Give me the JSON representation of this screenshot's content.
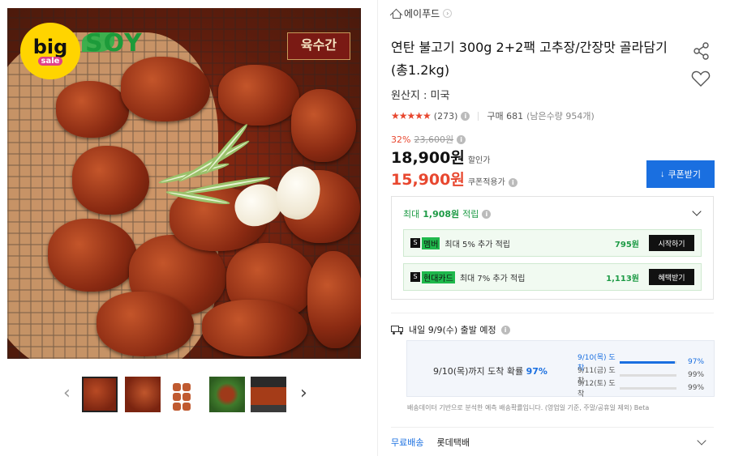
{
  "gallery": {
    "badge_big": "big",
    "badge_sale": "sale",
    "soy_logo": "SOY",
    "brand_seal": "육수간",
    "prev_arrow": "‹",
    "next_arrow": "›",
    "thumbnails": [
      "thumb-1",
      "thumb-2",
      "thumb-3",
      "thumb-4",
      "thumb-5"
    ],
    "active_thumb": 0
  },
  "product": {
    "store_name": "에이푸드",
    "title": "연탄 불고기 300g 2+2팩 고추장/간장맛 골라담기 (총1.2kg)",
    "origin": "원산지 : 미국",
    "stars": "★★★★★",
    "review_count": "(273)",
    "purchase_count": "구매 681",
    "remaining": "(남은수량 954개)",
    "discount_pct": "32%",
    "original_price": "23,600원",
    "sale_price": "18,900원",
    "sale_label": "할인가",
    "coupon_price": "15,900원",
    "coupon_label": "쿠폰적용가",
    "coupon_button": "쿠폰받기"
  },
  "rewards": {
    "header_prefix": "최대",
    "header_amount": "1,908원",
    "header_suffix": "적립",
    "items": [
      {
        "logo_box": "S",
        "logo_label": "멤버",
        "text": "최대 5% 추가 적립",
        "amount": "795원",
        "button": "시작하기"
      },
      {
        "logo_box": "S",
        "logo_label": "현대카드",
        "text": "최대 7% 추가 적립",
        "amount": "1,113원",
        "button": "혜택받기"
      }
    ]
  },
  "delivery": {
    "ship_text": "내일 9/9(수) 출발 예정",
    "arrival_prefix": "9/10(목)까지 도착 확률",
    "arrival_pct": "97%",
    "probabilities": [
      {
        "label": "9/10(목) 도착",
        "pct": "97%",
        "value": 97,
        "active": true
      },
      {
        "label": "9/11(금) 도착",
        "pct": "99%",
        "value": 99,
        "active": false
      },
      {
        "label": "9/12(토) 도착",
        "pct": "99%",
        "value": 99,
        "active": false
      }
    ],
    "note": "배송데이터 기반으로 분석한 예측 배송확률입니다. (영업일 기준, 주말/공휴일 제외) Beta",
    "free_shipping": "무료배송",
    "carrier": "롯데택배"
  },
  "colors": {
    "accent_blue": "#1a6fe0",
    "price_red": "#e8472f",
    "reward_green": "#1e9b46"
  }
}
